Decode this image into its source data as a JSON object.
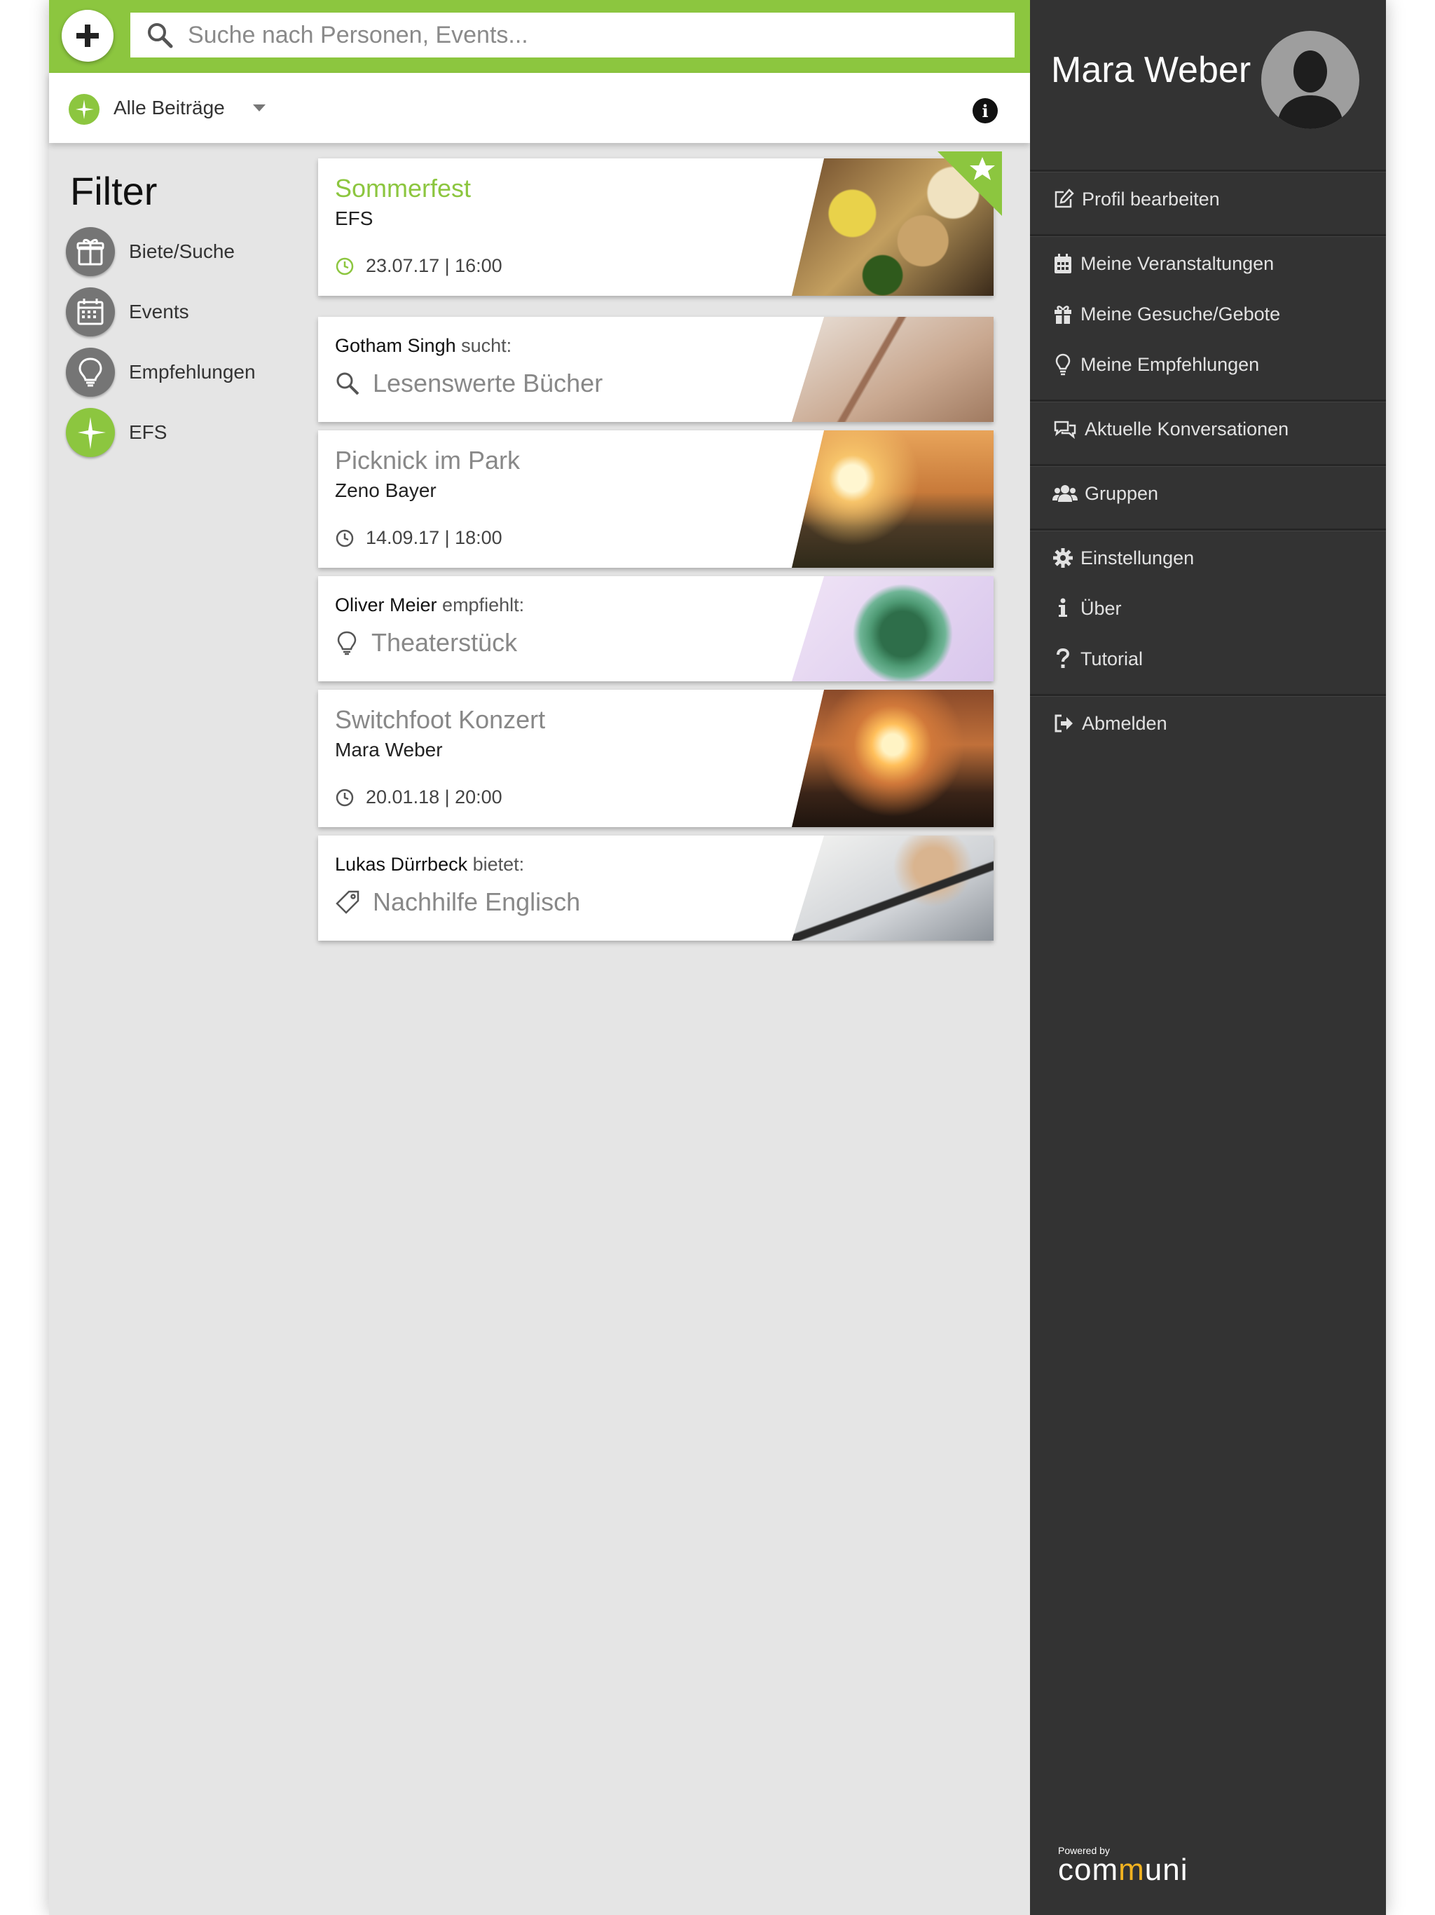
{
  "search": {
    "placeholder": "Suche nach Personen, Events..."
  },
  "feed": {
    "selected": "Alle Beiträge"
  },
  "filter": {
    "title": "Filter",
    "items": [
      {
        "label": "Biete/Suche",
        "icon": "gift-icon"
      },
      {
        "label": "Events",
        "icon": "calendar-icon"
      },
      {
        "label": "Empfehlungen",
        "icon": "lightbulb-icon"
      },
      {
        "label": "EFS",
        "icon": "efs-logo-icon"
      }
    ]
  },
  "cards": [
    {
      "type": "event",
      "title": "Sommerfest",
      "subtitle": "EFS",
      "date": "23.07.17 | 16:00",
      "starred": true,
      "accent": "#8cc63f"
    },
    {
      "type": "search",
      "name": "Gotham Singh",
      "verb": "sucht:",
      "item": "Lesenswerte Bücher",
      "icon": "search-icon"
    },
    {
      "type": "event",
      "title": "Picknick im Park",
      "subtitle": "Zeno Bayer",
      "date": "14.09.17 | 18:00"
    },
    {
      "type": "recommendation",
      "name": "Oliver Meier",
      "verb": "empfiehlt:",
      "item": "Theaterstück",
      "icon": "lightbulb-icon"
    },
    {
      "type": "event",
      "title": "Switchfoot Konzert",
      "subtitle": "Mara Weber",
      "date": "20.01.18 | 20:00"
    },
    {
      "type": "offer",
      "name": "Lukas Dürrbeck",
      "verb": "bietet:",
      "item": "Nachhilfe Englisch",
      "icon": "tag-icon"
    }
  ],
  "sidebar": {
    "user_name": "Mara Weber",
    "menu": [
      {
        "label": "Profil bearbeiten",
        "icon": "edit-icon"
      },
      {
        "label": "Meine Veranstaltungen",
        "icon": "calendar-icon"
      },
      {
        "label": "Meine Gesuche/Gebote",
        "icon": "gift-icon"
      },
      {
        "label": "Meine Empfehlungen",
        "icon": "lightbulb-icon"
      },
      {
        "label": "Aktuelle Konversationen",
        "icon": "chat-icon"
      },
      {
        "label": "Gruppen",
        "icon": "users-icon"
      },
      {
        "label": "Einstellungen",
        "icon": "gear-icon"
      },
      {
        "label": "Über",
        "icon": "info-icon"
      },
      {
        "label": "Tutorial",
        "icon": "question-icon"
      },
      {
        "label": "Abmelden",
        "icon": "logout-icon"
      }
    ],
    "powered_by": "Powered by",
    "brand_prefix": "com",
    "brand_accent": "m",
    "brand_suffix": "uni"
  },
  "colors": {
    "brand_green": "#8cc63f",
    "sidebar_bg": "#333333",
    "main_bg": "#e5e5e5",
    "logo_accent": "#f2b320"
  }
}
